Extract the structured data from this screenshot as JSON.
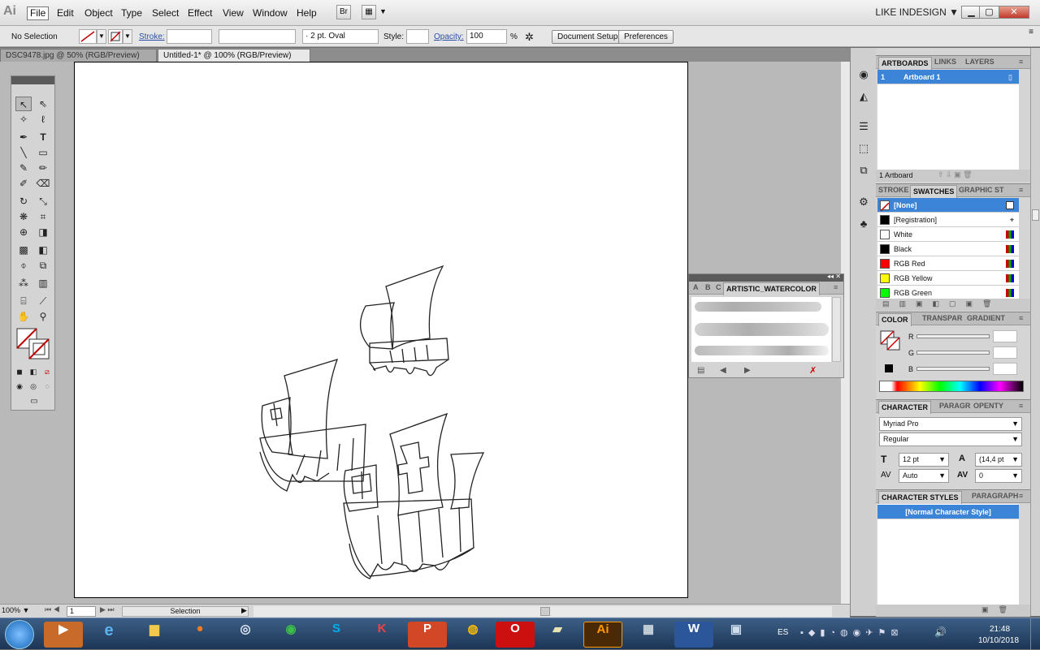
{
  "menubar": {
    "items": [
      "File",
      "Edit",
      "Object",
      "Type",
      "Select",
      "Effect",
      "View",
      "Window",
      "Help"
    ],
    "bridge_label": "Br",
    "workspace": "LIKE INDESIGN"
  },
  "control": {
    "selection": "No Selection",
    "stroke_label": "Stroke:",
    "brush": "2 pt. Oval",
    "style_label": "Style:",
    "opacity_label": "Opacity:",
    "opacity_value": "100",
    "percent": "%",
    "doc_setup": "Document Setup",
    "preferences": "Preferences"
  },
  "tabs": [
    {
      "label": "DSC9478.jpg @ 50% (RGB/Preview)"
    },
    {
      "label": "Untitled-1* @ 100% (RGB/Preview)"
    }
  ],
  "status": {
    "zoom": "100%",
    "artboard": "1",
    "tool": "Selection"
  },
  "artboards_panel": {
    "tabs": [
      "ARTBOARDS",
      "LINKS",
      "LAYERS"
    ],
    "item": "Artboard 1",
    "item_num": "1",
    "count": "1 Artboard"
  },
  "swatches_panel": {
    "tabs": [
      "STROKE",
      "SWATCHES",
      "GRAPHIC ST"
    ],
    "items": [
      {
        "name": "[None]",
        "color": "#ffffff"
      },
      {
        "name": "[Registration]",
        "color": "#000000"
      },
      {
        "name": "White",
        "color": "#ffffff"
      },
      {
        "name": "Black",
        "color": "#000000"
      },
      {
        "name": "RGB Red",
        "color": "#ff0000"
      },
      {
        "name": "RGB Yellow",
        "color": "#ffff00"
      },
      {
        "name": "RGB Green",
        "color": "#00ff00"
      }
    ]
  },
  "color_panel": {
    "tabs": [
      "COLOR",
      "TRANSPAR",
      "GRADIENT"
    ],
    "r": "R",
    "g": "G",
    "b": "B"
  },
  "character_panel": {
    "tabs": [
      "CHARACTER",
      "PARAGR",
      "OPENTY"
    ],
    "font": "Myriad Pro",
    "style": "Regular",
    "size": "12 pt",
    "leading": "(14,4 pt",
    "kerning": "Auto",
    "tracking": "0"
  },
  "char_styles_panel": {
    "tabs": [
      "CHARACTER STYLES",
      "PARAGRAPH"
    ],
    "item": "[Normal Character Style]"
  },
  "brush_panel": {
    "tabs": [
      "A",
      "B",
      "C"
    ],
    "title": "ARTISTIC_WATERCOLOR"
  },
  "taskbar": {
    "lang": "ES",
    "time": "21:48",
    "date": "10/10/2018"
  },
  "colors": {
    "accent": "#3b84d8",
    "none_red": "#c00000"
  }
}
